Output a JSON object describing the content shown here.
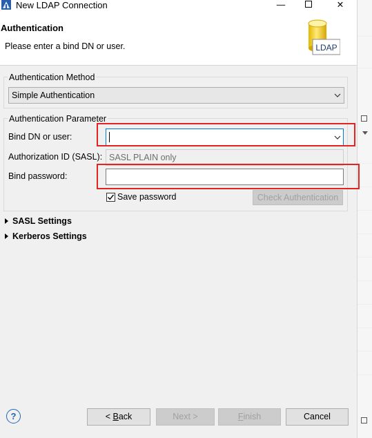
{
  "window": {
    "title": "New LDAP Connection",
    "minimize_glyph": "—",
    "maximize_glyph": "☐",
    "close_glyph": "✕"
  },
  "header": {
    "title": "Authentication",
    "description": "Please enter a bind DN or user.",
    "graphic_label": "LDAP"
  },
  "auth_method": {
    "legend": "Authentication Method",
    "selected": "Simple Authentication"
  },
  "auth_params": {
    "legend": "Authentication Parameter",
    "bind_label": "Bind DN or user:",
    "bind_value": "",
    "authz_label": "Authorization ID (SASL):",
    "authz_placeholder": "SASL PLAIN only",
    "password_label": "Bind password:",
    "password_value": "",
    "save_password_label": "Save password",
    "save_password_checked": true,
    "check_button": "Check Authentication"
  },
  "sections": {
    "sasl": "SASL Settings",
    "kerberos": "Kerberos Settings"
  },
  "footer": {
    "help": "?",
    "back_prefix": "< ",
    "back_mnemonic": "B",
    "back_rest": "ack",
    "next": "Next >",
    "finish_mnemonic": "F",
    "finish_rest": "inish",
    "cancel": "Cancel"
  },
  "colors": {
    "highlight": "#e32222",
    "focus_border": "#0078d7",
    "dialog_bg": "#f0f0f0"
  }
}
